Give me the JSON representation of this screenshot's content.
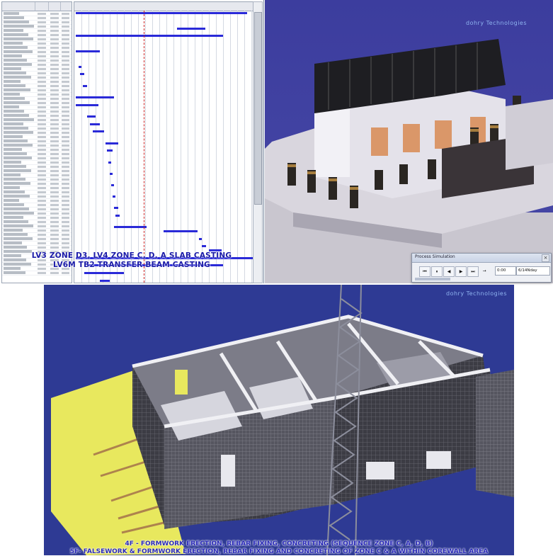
{
  "gantt": {
    "rows": 62
  },
  "captions": {
    "top_line1": "LV3 ZONE D3, LV4 ZONE C, D, A SLAB CASTING",
    "top_line2": "LV6M TB2 TRANSFER BEAM CASTING",
    "bottom_line1": "4F - FORMWORK ERECTION, REBAR FIXING, CONCRETING (SEQUENCE ZONE C, A, D, B)",
    "bottom_line2": "5F- FALSEWORK & FORMWORK ERECTION, REBAR FIXING AND CONCRETING OF ZONE C & A WITHIN COREWALL AREA"
  },
  "logos": {
    "top": "dohry Technologies",
    "bottom": "dohry Technologies"
  },
  "simulation": {
    "title": "Process Simulation",
    "close_label": "×",
    "buttons": [
      "⏮",
      "⏸",
      "◀",
      "▶",
      "⏭",
      "→"
    ],
    "time_value": "0:00",
    "date_value": "6/14Nday"
  },
  "colors": {
    "bar": "#2a2ad8",
    "today_line": "#cc2222",
    "viewport_bg": "#3a3c9a",
    "caption": "#1a1aa8"
  },
  "icons": {
    "close": "close-icon",
    "first": "skip-back-icon",
    "pause": "pause-icon",
    "step_back": "step-back-icon",
    "play": "play-icon",
    "last": "skip-forward-icon",
    "arrow": "arrow-right-icon"
  }
}
